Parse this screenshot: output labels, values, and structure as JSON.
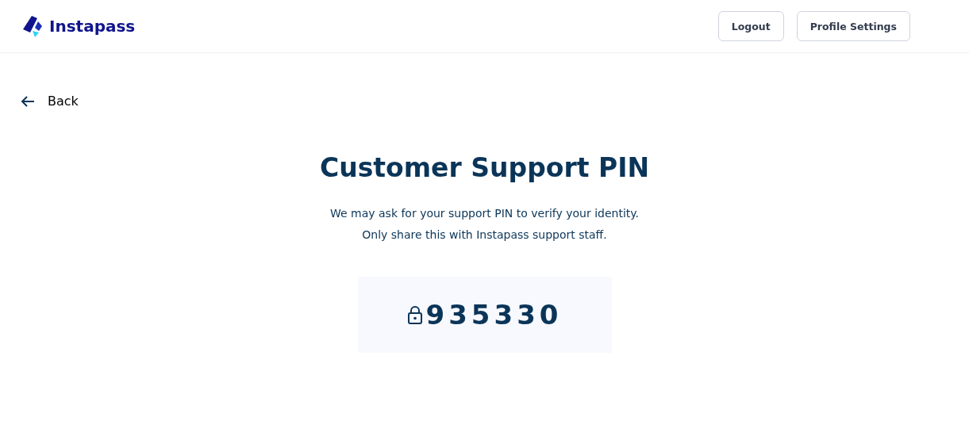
{
  "header": {
    "brand": "Instapass",
    "buttons": [
      "Logout",
      "Profile Settings"
    ]
  },
  "back": {
    "label": "Back"
  },
  "title": "Customer Support PIN",
  "description": [
    "We may ask for your support PIN to verify your identity.",
    "Only share this with Instapass support staff."
  ],
  "pin": "935330"
}
